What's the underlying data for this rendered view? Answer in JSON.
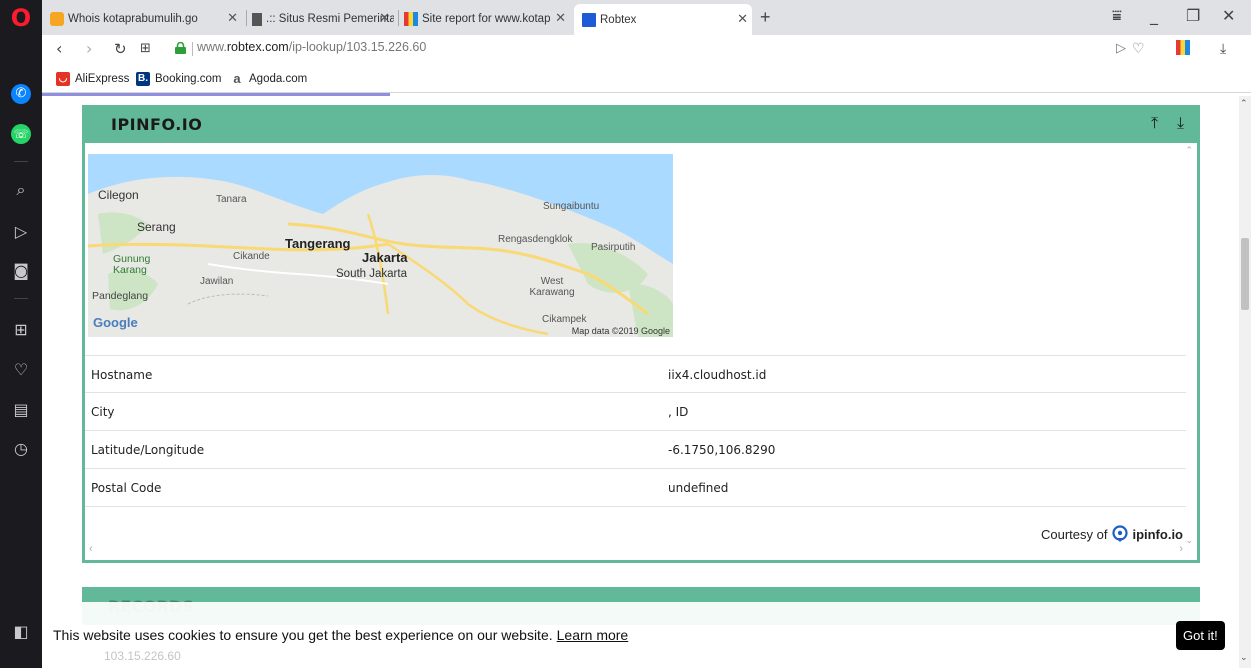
{
  "browser": {
    "tabs": [
      {
        "label": "Whois kotaprabumulih.go"
      },
      {
        "label": ".:: Situs Resmi Pemerintah"
      },
      {
        "label": "Site report for www.kotap"
      },
      {
        "label": "Robtex"
      }
    ],
    "url_host": "www.",
    "url_domain": "robtex.com",
    "url_path": "/ip-lookup/103.15.226.60",
    "bookmarks": [
      {
        "label": "AliExpress"
      },
      {
        "label": "Booking.com"
      },
      {
        "label": "Agoda.com"
      }
    ]
  },
  "panel": {
    "title": "IPINFO.IO",
    "map_labels": [
      {
        "text": "Cilegon"
      },
      {
        "text": "Tanara"
      },
      {
        "text": "Serang"
      },
      {
        "text": "Tangerang"
      },
      {
        "text": "Jakarta"
      },
      {
        "text": "South Jakarta"
      },
      {
        "text": "Cikande"
      },
      {
        "text": "Gunung Karang"
      },
      {
        "text": "Jawilan"
      },
      {
        "text": "Pandeglang"
      },
      {
        "text": "Sungaibuntu"
      },
      {
        "text": "Rengasdengklok"
      },
      {
        "text": "Pasirputih"
      },
      {
        "text": "West Karawang"
      },
      {
        "text": "Cikampek"
      }
    ],
    "map_copyright": "Map data ©2019 Google",
    "map_logo": "Google",
    "rows": [
      {
        "key": "Hostname",
        "value": "iix4.cloudhost.id"
      },
      {
        "key": "City",
        "value": ", ID"
      },
      {
        "key": "Latitude/Longitude",
        "value": "-6.1750,106.8290"
      },
      {
        "key": "Postal Code",
        "value": "undefined"
      }
    ],
    "courtesy_prefix": "Courtesy of",
    "courtesy_brand": "ipinfo.io"
  },
  "records": {
    "title": "RECORDS",
    "ip": "103.15.226.60"
  },
  "cookie": {
    "text": "This website uses cookies to ensure you get the best experience on our website.",
    "link": "Learn more",
    "button": "Got it!"
  },
  "colors": {
    "panel_green": "#62b999",
    "opera_red": "#ff1b2d"
  }
}
